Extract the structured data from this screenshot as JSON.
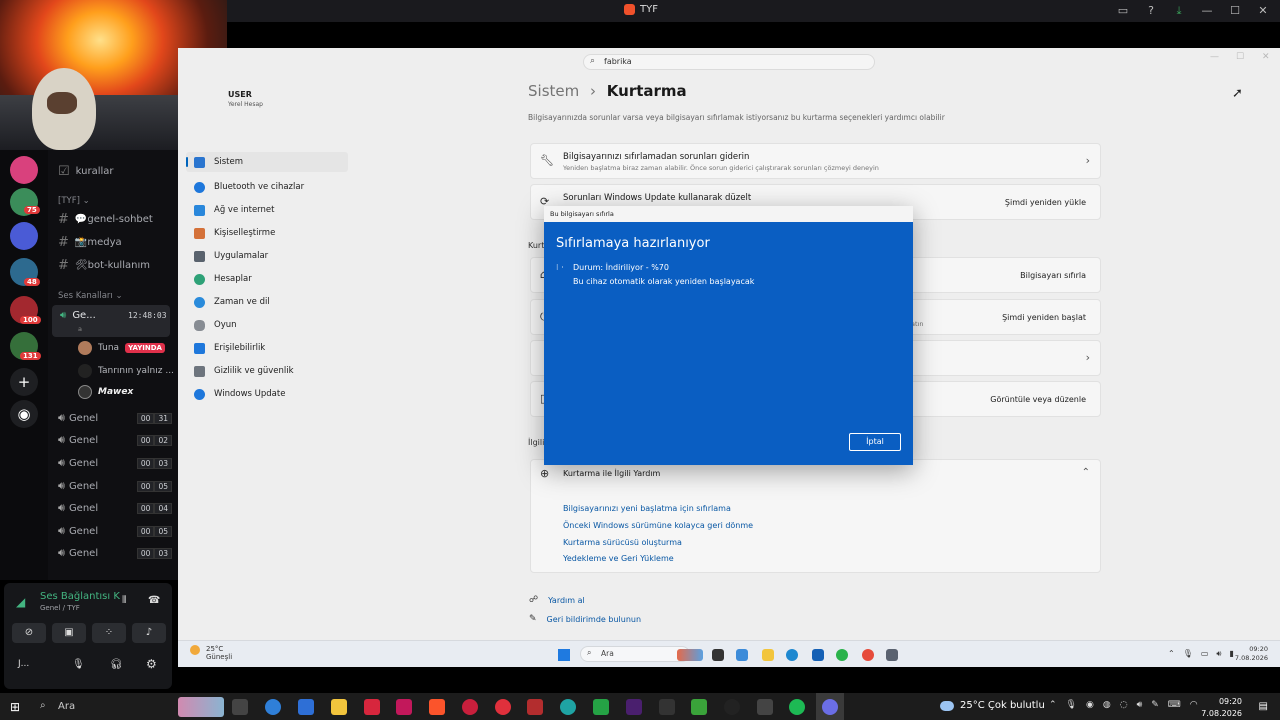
{
  "topbar": {
    "title": "TYF"
  },
  "discord": {
    "rail_badges": [
      "75",
      "48",
      "100",
      "131"
    ],
    "channels": {
      "rules": "kurallar",
      "category_tyf": "[TYF] ⌄",
      "general_chat": "💬genel-sohbet",
      "media": "📸medya",
      "bot_usage": "🛠bot-kullanım",
      "voice_category": "Ses Kanalları ⌄"
    },
    "active_voice": {
      "name": "Ge...",
      "timer": "12:48:03",
      "sub": "a"
    },
    "members": [
      {
        "name": "Tuna",
        "badge": "YAYINDA"
      },
      {
        "name": "Tanrının yalnız ..."
      },
      {
        "name": "Mawex"
      }
    ],
    "voice_channels": [
      {
        "name": "Genel",
        "a": "00",
        "b": "31"
      },
      {
        "name": "Genel",
        "a": "00",
        "b": "02"
      },
      {
        "name": "Genel",
        "a": "00",
        "b": "03"
      },
      {
        "name": "Genel",
        "a": "00",
        "b": "05"
      },
      {
        "name": "Genel",
        "a": "00",
        "b": "04"
      },
      {
        "name": "Genel",
        "a": "00",
        "b": "05"
      },
      {
        "name": "Genel",
        "a": "00",
        "b": "03"
      }
    ],
    "voice_panel": {
      "title": "Ses Bağlantısı K",
      "subtitle": "Genel / TYF",
      "user": "J..."
    }
  },
  "settings": {
    "user": {
      "name": "USER",
      "account": "Yerel Hesap"
    },
    "search_value": "fabrika",
    "breadcrumb": {
      "parent": "Sistem",
      "current": "Kurtarma"
    },
    "description": "Bilgisayarınızda sorunlar varsa veya bilgisayarı sıfırlamak istiyorsanız bu kurtarma seçenekleri yardımcı olabilir",
    "nav": [
      {
        "label": "Sistem",
        "color": "#2b78d4"
      },
      {
        "label": "Bluetooth ve cihazlar",
        "color": "#1f7ae0"
      },
      {
        "label": "Ağ ve internet",
        "color": "#2a8ae0"
      },
      {
        "label": "Kişiselleştirme",
        "color": "#d9743b"
      },
      {
        "label": "Uygulamalar",
        "color": "#5b6470"
      },
      {
        "label": "Hesaplar",
        "color": "#2fa57a"
      },
      {
        "label": "Zaman ve dil",
        "color": "#2b8ee0"
      },
      {
        "label": "Oyun",
        "color": "#8a8f96"
      },
      {
        "label": "Erişilebilirlik",
        "color": "#1f7ae0"
      },
      {
        "label": "Gizlilik ve güvenlik",
        "color": "#707780"
      },
      {
        "label": "Windows Update",
        "color": "#1f7ae0"
      }
    ],
    "cards": {
      "fix_title": "Bilgisayarınızı sıfırlamadan sorunları giderin",
      "fix_sub": "Yeniden başlatma biraz zaman alabilir. Önce sorun giderici çalıştırarak sorunları çözmeyi deneyin",
      "wu_title": "Sorunları Windows Update kullanarak düzelt",
      "wu_button": "Şimdi yeniden yükle",
      "reset_button": "Bilgisayarı sıfırla",
      "restart_button": "Şimdi yeniden başlat",
      "restart_side": "atın",
      "view_button": "Görüntüle veya düzenle"
    },
    "section_label_1": "Kurt",
    "section_label_2": "İlgili",
    "help": {
      "title": "Kurtarma ile İlgili Yardım",
      "links": [
        "Bilgisayarınızı yeni başlatma için sıfırlama",
        "Önceki Windows sürümüne kolayca geri dönme",
        "Kurtarma sürücüsü oluşturma",
        "Yedekleme ve Geri Yükleme"
      ]
    },
    "footer": {
      "get_help": "Yardım al",
      "feedback": "Geri bildirimde bulunun"
    }
  },
  "dialog": {
    "header": "Bu bilgisayarı sıfırla",
    "title": "Sıfırlamaya hazırlanıyor",
    "spinner": "⁝ ·",
    "status": "Durum: İndiriliyor - %70",
    "restart_note": "Bu cihaz otomatik olarak yeniden başlayacak",
    "cancel": "İptal"
  },
  "inner_taskbar": {
    "weather_temp": "25°C",
    "weather_desc": "Güneşli",
    "search": "Ara",
    "time": "09:20",
    "date": "7.08.2026"
  },
  "host_taskbar": {
    "search": "Ara",
    "weather": "25°C  Çok bulutlu",
    "time": "09:20",
    "date": "7.08.2026"
  }
}
